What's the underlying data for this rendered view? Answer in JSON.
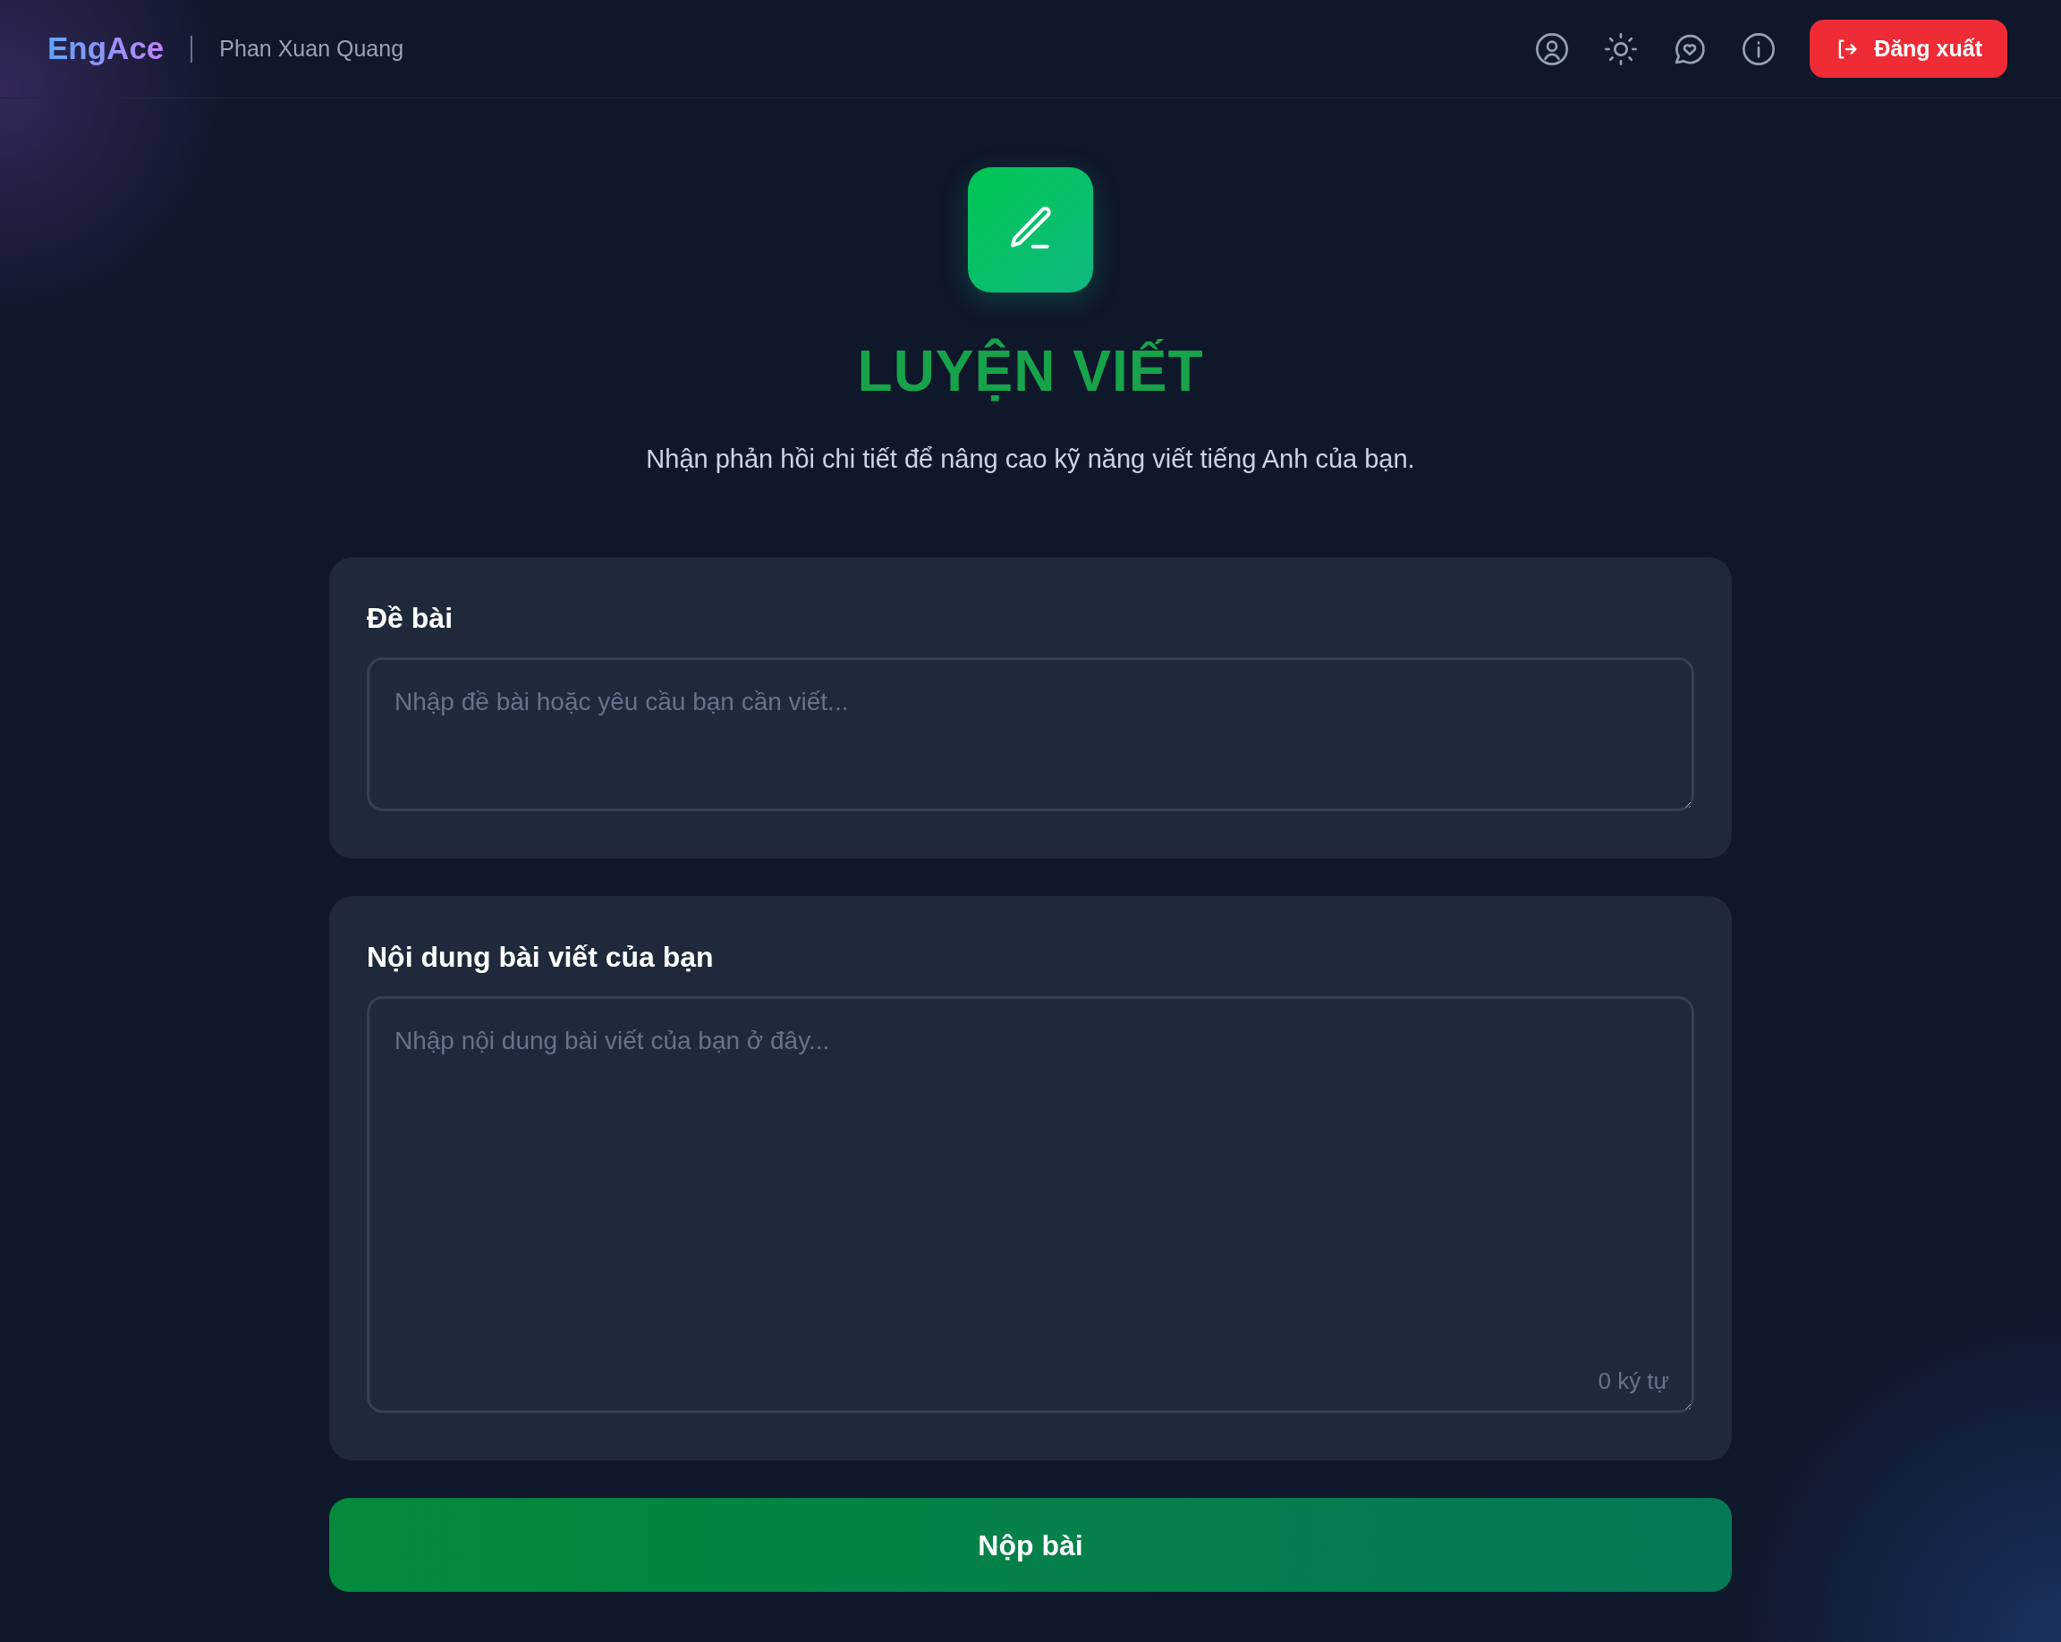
{
  "header": {
    "brand": "EngAce",
    "user": "Phan Xuan Quang",
    "logout_button": "Đăng xuất"
  },
  "hero": {
    "title": "LUYỆN VIẾT",
    "subtitle": "Nhận phản hồi chi tiết để nâng cao kỹ năng viết tiếng Anh của bạn."
  },
  "fields": [
    {
      "label": "Đề bài",
      "placeholder": "Nhập đề bài hoặc yêu cầu bạn cần viết...",
      "kind": "short"
    },
    {
      "label": "Nội dung bài viết của bạn",
      "placeholder": "Nhập nội dung bài viết của bạn ở đây...",
      "kind": "long",
      "counter": "0 ký tự"
    }
  ],
  "submit_button": "Nộp bài"
}
